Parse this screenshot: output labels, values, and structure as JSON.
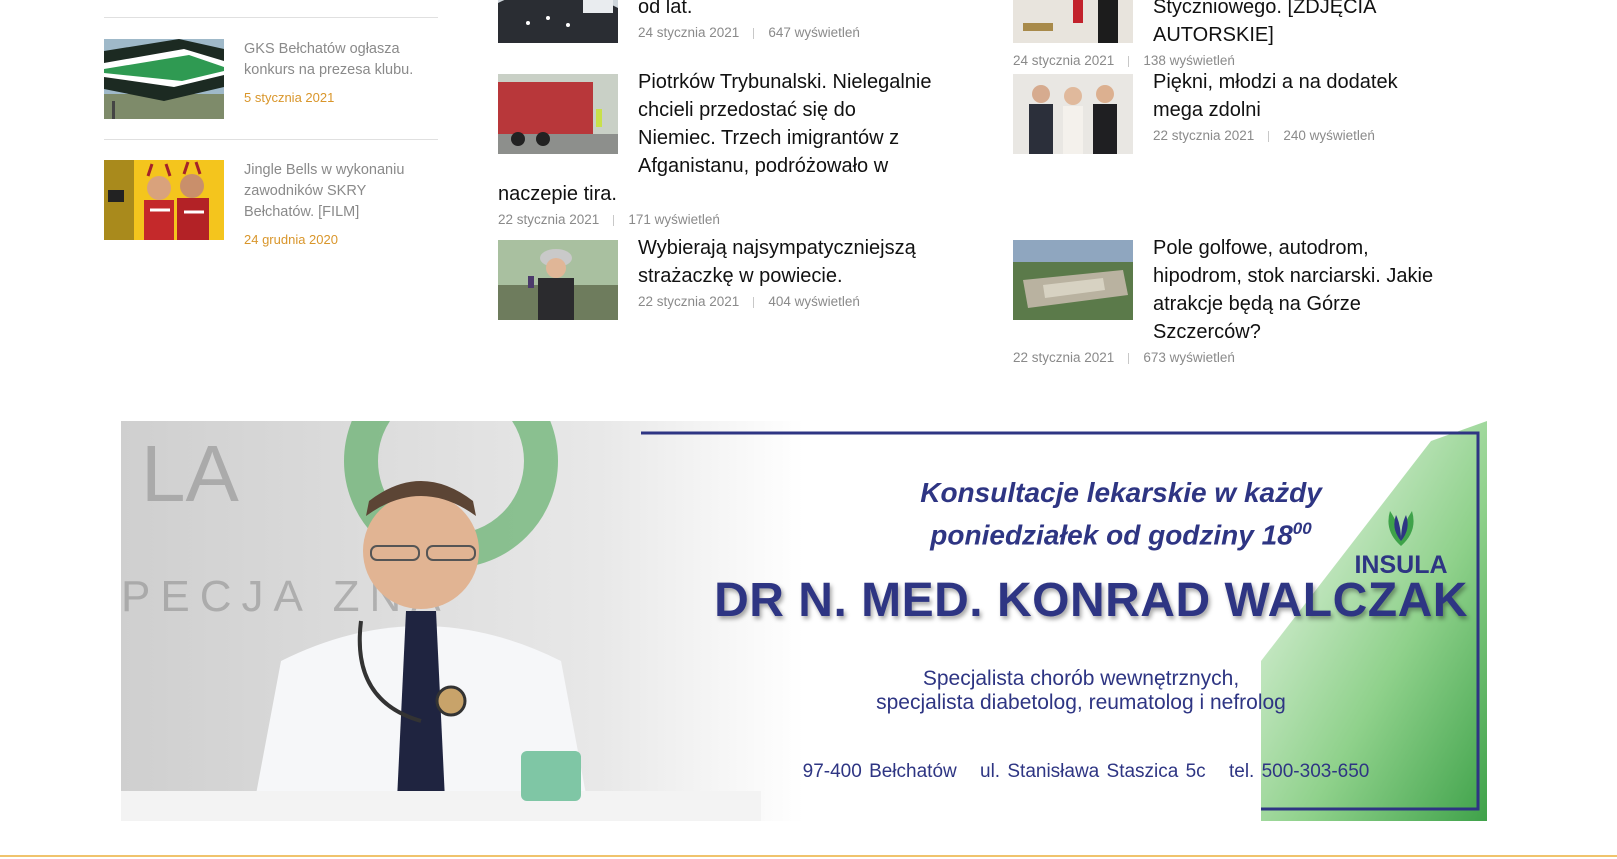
{
  "sidebar": {
    "items": [
      {
        "title": "GKS Bełchatów ogłasza konkurs na prezesa klubu.",
        "date": "5 stycznia 2021"
      },
      {
        "title": "Jingle Bells w wykonaniu zawodników SKRY Bełchatów. [FILM]",
        "date": "24 grudnia 2020"
      }
    ]
  },
  "articles": {
    "col1": [
      {
        "title": "od lat.",
        "date": "24 stycznia 2021",
        "views": "647 wyświetleń"
      },
      {
        "title": "Piotrków Trybunalski. Nielegalnie chcieli przedostać się do Niemiec. Trzech imigrantów z Afganistanu, podróżowało w naczepie tira.",
        "date": "22 stycznia 2021",
        "views": "171 wyświetleń"
      },
      {
        "title": "Wybierają najsympatyczniejszą strażaczkę w powiecie.",
        "date": "22 stycznia 2021",
        "views": "404 wyświetleń"
      }
    ],
    "col2": [
      {
        "title": "Styczniowego. [ZDJĘCIA AUTORSKIE]",
        "date": "24 stycznia 2021",
        "views": "138 wyświetleń"
      },
      {
        "title": "Piękni, młodzi a na dodatek mega zdolni",
        "date": "22 stycznia 2021",
        "views": "240 wyświetleń"
      },
      {
        "title": "Pole golfowe, autodrom, hipodrom, stok narciarski. Jakie atrakcje będą na Górze Szczerców?",
        "date": "22 stycznia 2021",
        "views": "673 wyświetleń"
      }
    ]
  },
  "banner": {
    "line1": "Konsultacje lekarskie w każdy",
    "line2": "poniedziałek od godziny 18",
    "line2_sup": "00",
    "doctor_name": "DR N. MED. KONRAD WALCZAK",
    "spec1": "Specjalista chorób wewnętrznych,",
    "spec2": "specjalista diabetolog, reumatolog i nefrolog",
    "postal": "97-400 Bełchatów",
    "street": "ul. Stanisława Staszica 5c",
    "phone": "tel. 500-303-650",
    "logo": "INSULA"
  },
  "colors": {
    "accent_date": "#d9962b",
    "banner_navy": "#2e3583",
    "banner_green": "#3fa24a"
  }
}
